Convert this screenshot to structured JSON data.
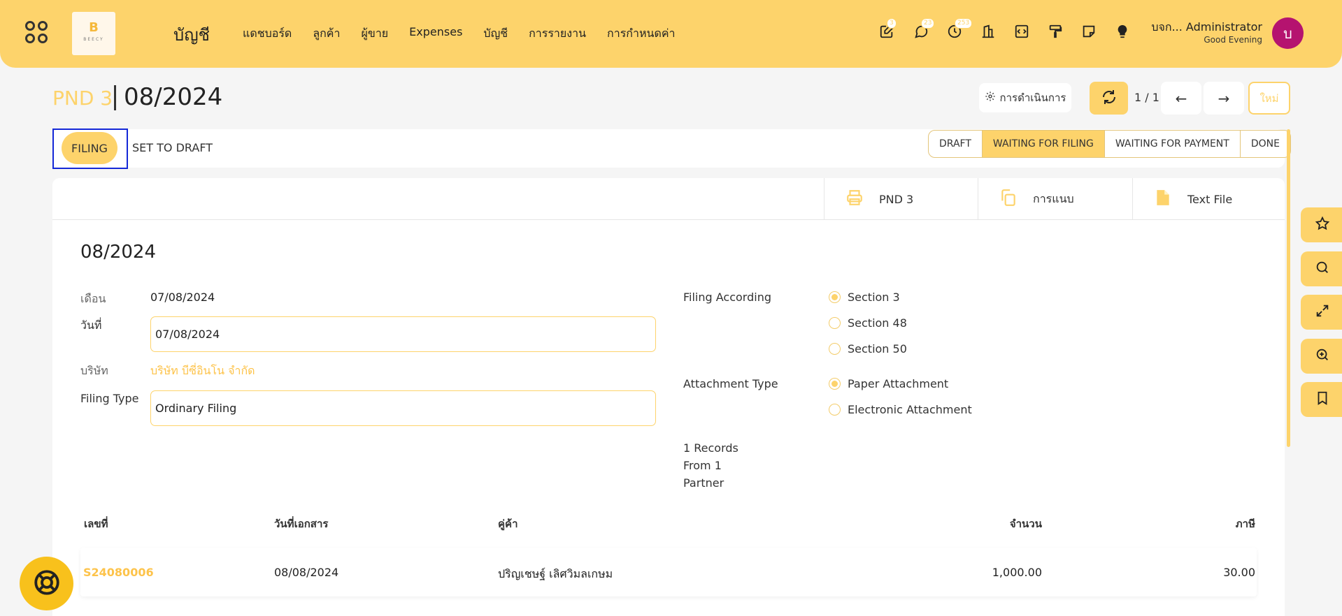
{
  "header": {
    "app_title": "บัญชี",
    "logo_mark": "B",
    "logo_text": "BEECY",
    "nav": [
      "แดชบอร์ด",
      "ลูกค้า",
      "ผู้ขาย",
      "Expenses",
      "บัญชี",
      "การรายงาน",
      "การกำหนดค่า"
    ],
    "badges": {
      "edit": "3",
      "chat": "23",
      "activity": "253"
    },
    "user_name": "บจก... Administrator",
    "greeting": "Good Evening",
    "avatar_letter": "บ"
  },
  "breadcrumb": {
    "parent": "PND 3",
    "current": "08/2024"
  },
  "controls": {
    "actions_label": "การดำเนินการ",
    "pager": "1 / 1",
    "new_label": "ใหม่"
  },
  "statusbar": {
    "filing_label": "FILING",
    "set_draft_label": "SET TO DRAFT",
    "stages": [
      "DRAFT",
      "WAITING FOR FILING",
      "WAITING FOR PAYMENT",
      "DONE"
    ],
    "active_stage": "WAITING FOR FILING"
  },
  "smart_buttons": [
    "PND 3",
    "การแนบ",
    "Text File"
  ],
  "form": {
    "record_name": "08/2024",
    "month_label": "เดือน",
    "month_value": "07/08/2024",
    "date_label": "วันที่",
    "date_value": "07/08/2024",
    "company_label": "บริษัท",
    "company_value": "บริษัท บีซี่อินโน จำกัด",
    "filing_type_label": "Filing Type",
    "filing_type_value": "Ordinary Filing",
    "filing_according_label": "Filing According",
    "filing_according_options": [
      "Section 3",
      "Section 48",
      "Section 50"
    ],
    "filing_according_selected": "Section 3",
    "attachment_type_label": "Attachment Type",
    "attachment_type_options": [
      "Paper Attachment",
      "Electronic Attachment"
    ],
    "attachment_type_selected": "Paper Attachment",
    "records_line1": "1 Records",
    "records_line2": "From 1",
    "records_line3": "Partner"
  },
  "table": {
    "headers": [
      "เลขที่",
      "วันที่เอกสาร",
      "คู่ค้า",
      "จำนวน",
      "ภาษี"
    ],
    "rows": [
      {
        "number": "S24080006",
        "date": "08/08/2024",
        "partner": "ปริญเชษฐ์ เลิศวิมลเกษม",
        "amount": "1,000.00",
        "tax": "30.00"
      }
    ]
  },
  "colors": {
    "brand": "#fdd36b",
    "highlight_box": "#1428d7",
    "avatar": "#b5136f"
  }
}
